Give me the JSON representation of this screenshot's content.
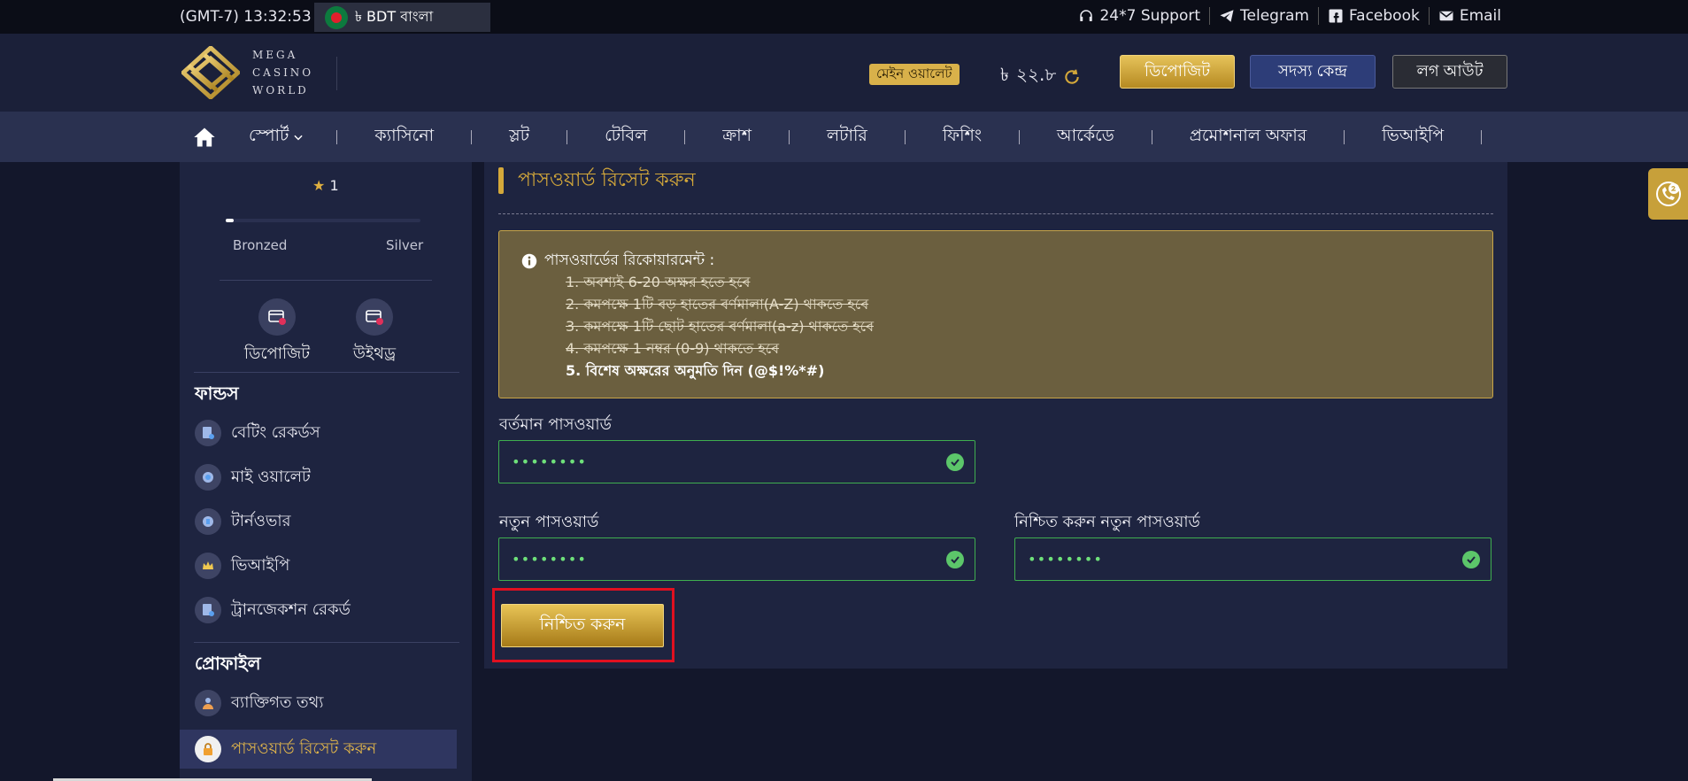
{
  "topbar": {
    "time": "(GMT-7) 13:32:53",
    "currency_lang": "৳ BDT বাংলা",
    "links": [
      "24*7 Support",
      "Telegram",
      "Facebook",
      "Email"
    ]
  },
  "header": {
    "logo_lines": [
      "MEGA",
      "CASINO",
      "WORLD"
    ],
    "wallet_label": "মেইন ওয়ালেট",
    "currency_symbol": "৳",
    "balance": "২২.৮",
    "deposit": "ডিপোজিট",
    "member_center": "সদস্য কেন্দ্র",
    "logout": "লগ আউট"
  },
  "nav": {
    "items": [
      "স্পোর্ট",
      "ক্যাসিনো",
      "স্লট",
      "টেবিল",
      "ক্রাশ",
      "লটারি",
      "ফিশিং",
      "আর্কেডে",
      "প্রমোশনাল অফার",
      "ভিআইপি"
    ]
  },
  "sidebar": {
    "star_level": "1",
    "level_progress": 0.01,
    "level_from": "Bronzed",
    "level_to": "Silver",
    "quick_actions": [
      "ডিপোজিট",
      "উইথড্র"
    ],
    "funds_title": "ফান্ডস",
    "funds_items": [
      "বেটিং রেকর্ডস",
      "মাই ওয়ালেট",
      "টার্নওভার",
      "ভিআইপি",
      "ট্রানজেকশন রেকর্ড"
    ],
    "profile_title": "প্রোফাইল",
    "profile_items": [
      "ব্যাক্তিগত তথ্য",
      "পাসওয়ার্ড রিসেট করুন"
    ]
  },
  "main": {
    "title": "পাসওয়ার্ড রিসেট করুন",
    "req_heading": "পাসওয়ার্ডের রিকোয়ারমেন্ট :",
    "requirements": [
      "1. অবশ্যই 6-20 অক্ষর হতে হবে",
      "2. কমপক্ষে 1টি বড় হাতের বর্ণমালা(A-Z) থাকতে হবে",
      "3. কমপক্ষে 1টি ছোট হাতের বর্ণমালা(a-z) থাকতে হবে",
      "4. কমপক্ষে 1 নম্বর (0-9) থাকতে হবে",
      "5. বিশেষ অক্ষরের অনুমতি দিন (@$!%*#)"
    ],
    "current_label": "বর্তমান পাসওয়ার্ড",
    "current_value": "••••••••",
    "new_label": "নতুন পাসওয়ার্ড",
    "new_value": "••••••••",
    "confirm_label": "নিশ্চিত করুন নতুন পাসওয়ার্ড",
    "confirm_value": "••••••••",
    "submit": "নিশ্চিত করুন"
  },
  "colors": {
    "accent_gold": "#d4a83a",
    "valid_green": "#5cc66a",
    "highlight_red": "#e01020"
  }
}
